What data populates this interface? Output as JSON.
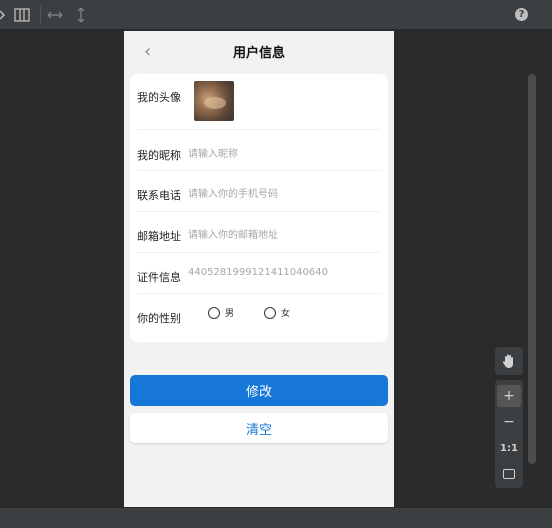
{
  "toolbar": {
    "icons": [
      "device-icon",
      "split-view-icon",
      "width-icon",
      "height-icon",
      "help-icon"
    ],
    "help_label": "?"
  },
  "page": {
    "title": "用户信息",
    "back_glyph": "‹"
  },
  "form": {
    "avatar_label": "我的头像",
    "nickname": {
      "label": "我的昵称",
      "placeholder": "请输入昵称"
    },
    "phone": {
      "label": "联系电话",
      "placeholder": "请输入你的手机号码"
    },
    "email": {
      "label": "邮箱地址",
      "placeholder": "请输入你的邮箱地址"
    },
    "id_info": {
      "label": "证件信息",
      "value": "440528199912141104064​0"
    },
    "gender": {
      "label": "你的性别",
      "options": [
        "男",
        "女"
      ]
    }
  },
  "buttons": {
    "modify": "修改",
    "clear": "清空"
  },
  "zoom": {
    "hand": "✋",
    "zoom_in": "+",
    "zoom_out": "−",
    "one_to_one": "1:1"
  },
  "colors": {
    "primary": "#1677d8",
    "background": "#f2f2f2"
  }
}
